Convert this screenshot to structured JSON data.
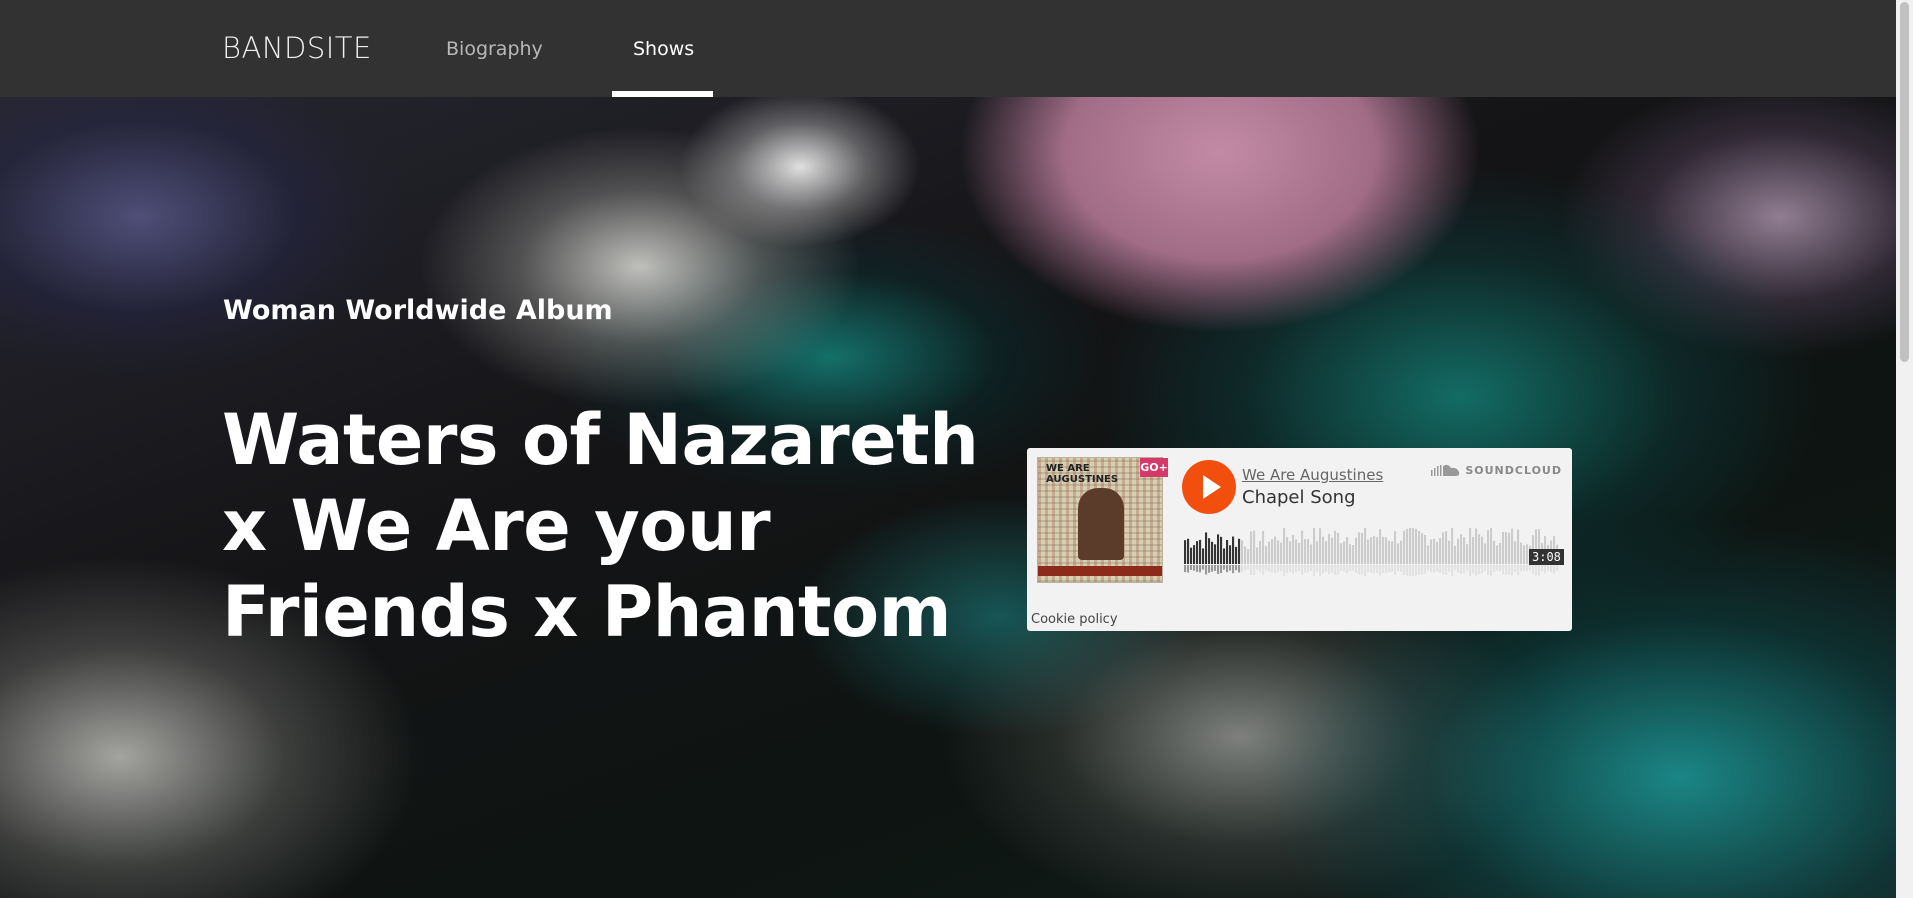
{
  "nav": {
    "brand": "BANDSITE",
    "links": [
      {
        "label": "Biography"
      },
      {
        "label": "Shows"
      }
    ]
  },
  "hero": {
    "subtitle": "Woman Worldwide Album",
    "title": "Waters of Nazareth x We Are your Friends x Phantom"
  },
  "player": {
    "album_art_text": "WE ARE AUGUSTINES",
    "badge": "GO+",
    "artist": "We Are Augustines",
    "track": "Chapel Song",
    "brand": "SOUNDCLOUD",
    "duration": "3:08",
    "progress": 0.15,
    "cookie_policy": "Cookie policy",
    "colors": {
      "play": "#f24f0f",
      "badge": "#d4396a",
      "wave_played": "#333333",
      "wave_unplayed": "#cccccc"
    }
  }
}
